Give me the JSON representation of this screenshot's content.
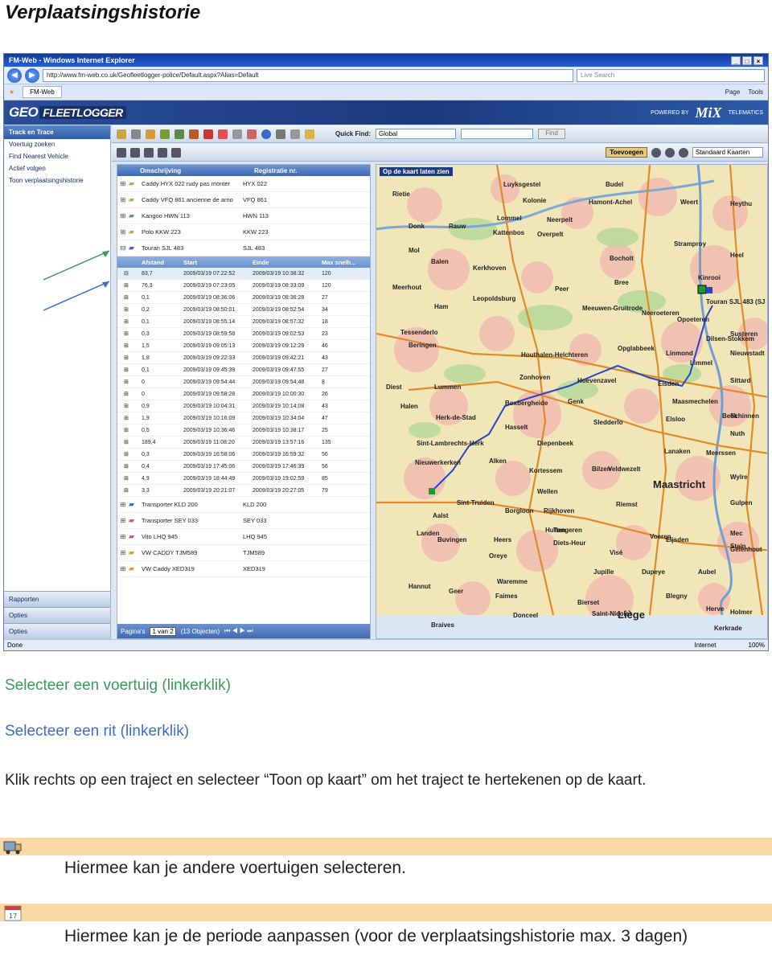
{
  "doc_title": "Verplaatsingshistorie",
  "browser": {
    "title": "FM-Web - Windows Internet Explorer",
    "url": "http://www.fm-web.co.uk/Geofleetlogger-police/Default.aspx?Alias=Default",
    "search_placeholder": "Live Search",
    "tab": "FM-Web",
    "tools": [
      "Page",
      "Tools"
    ],
    "status_left": "Done",
    "status_zone": "Internet",
    "zoom": "100%"
  },
  "app": {
    "logo_geo": "GEO",
    "logo_fleet": "FLEETLOGGER",
    "powered_by": "POWERED BY",
    "mix": "MiX",
    "telematics": "TELEMATICS"
  },
  "left_menu": {
    "header": "Track en Trace",
    "items": [
      "Voertuig zoeken",
      "Find Nearest Vehicle",
      "Actief volgen",
      "Toon verplaatsingshistorie"
    ],
    "bottom": [
      "Rapporten",
      "Opties",
      "Opties"
    ]
  },
  "toolbar": {
    "quick_find_label": "Quick Find:",
    "quick_find_value": "Global",
    "find_button": "Find",
    "add_button": "Toevoegen",
    "map_select": "Standaard Kaarten"
  },
  "grid": {
    "columns": [
      "Omschrijving",
      "Registratie nr."
    ],
    "vehicles_top": [
      {
        "name": "Caddy HYX 022 rudy pas monter",
        "reg": "HYX 022"
      },
      {
        "name": "Caddy VFQ 861 ancienne de arno",
        "reg": "VFQ 861"
      },
      {
        "name": "Kangoo HWN 113",
        "reg": "HWN 113"
      },
      {
        "name": "Polo KKW 223",
        "reg": "KKW 223"
      },
      {
        "name": "Touran SJL 483",
        "reg": "SJL 483"
      }
    ],
    "trip_columns": [
      "Afstand",
      "Start",
      "Einde",
      "Max snelh..."
    ],
    "trips": [
      {
        "d": "83,7",
        "s": "2009/03/19 07:22:52",
        "e": "2009/03/19 10:38:32",
        "m": "120"
      },
      {
        "d": "76,3",
        "s": "2009/03/19 07:23:05",
        "e": "2009/03/19 08:33:09",
        "m": "120"
      },
      {
        "d": "0,1",
        "s": "2009/03/19 08:36:06",
        "e": "2009/03/19 08:36:28",
        "m": "27"
      },
      {
        "d": "0,2",
        "s": "2009/03/19 08:50:01",
        "e": "2009/03/19 08:52:54",
        "m": "34"
      },
      {
        "d": "0,1",
        "s": "2009/03/19 08:55:14",
        "e": "2009/03/19 08:57:32",
        "m": "18"
      },
      {
        "d": "0,3",
        "s": "2009/03/19 08:59:58",
        "e": "2009/03/19 09:02:53",
        "m": "23"
      },
      {
        "d": "1,5",
        "s": "2009/03/19 09:05:13",
        "e": "2009/03/19 09:12:29",
        "m": "46"
      },
      {
        "d": "1,8",
        "s": "2009/03/19 09:22:33",
        "e": "2009/03/19 09:42:21",
        "m": "43"
      },
      {
        "d": "0,1",
        "s": "2009/03/19 09:45:39",
        "e": "2009/03/19 09:47:55",
        "m": "27"
      },
      {
        "d": "0",
        "s": "2009/03/19 09:54:44",
        "e": "2009/03/19 09:54:48",
        "m": "8"
      },
      {
        "d": "0",
        "s": "2009/03/19 09:58:28",
        "e": "2009/03/19 10:00:30",
        "m": "26"
      },
      {
        "d": "0,9",
        "s": "2009/03/19 10:04:31",
        "e": "2009/03/19 10:14:08",
        "m": "43"
      },
      {
        "d": "1,9",
        "s": "2009/03/19 10:16:09",
        "e": "2009/03/19 10:34:04",
        "m": "47"
      },
      {
        "d": "0,5",
        "s": "2009/03/19 10:36:46",
        "e": "2009/03/19 10:38:17",
        "m": "25"
      },
      {
        "d": "189,4",
        "s": "2009/03/19 11:08:20",
        "e": "2009/03/19 13:57:16",
        "m": "135"
      },
      {
        "d": "0,3",
        "s": "2009/03/19 16:58:06",
        "e": "2009/03/19 16:59:32",
        "m": "56"
      },
      {
        "d": "0,4",
        "s": "2009/03/19 17:45:06",
        "e": "2009/03/19 17:46:39",
        "m": "56"
      },
      {
        "d": "4,9",
        "s": "2009/03/19 18:44:49",
        "e": "2009/03/19 19:02:59",
        "m": "85"
      },
      {
        "d": "3,3",
        "s": "2009/03/19 20:21:07",
        "e": "2009/03/19 20:27:05",
        "m": "79"
      }
    ],
    "vehicles_bottom": [
      {
        "name": "Transporter KLD 200",
        "reg": "KLD 200"
      },
      {
        "name": "Transporter SEY 033",
        "reg": "SEY 033"
      },
      {
        "name": "Vito LHQ 945",
        "reg": "LHQ 945"
      },
      {
        "name": "VW CADDY TJM589",
        "reg": "TJM589"
      },
      {
        "name": "VW Caddy XED319",
        "reg": "XED319"
      }
    ],
    "pager_label": "Pagina's",
    "pager_value": "1 van 2",
    "pager_count": "(13 Objecten)"
  },
  "map": {
    "header": "Op de kaart laten zien",
    "labels": [
      "Luyksgestel",
      "Budel",
      "Kolonie",
      "Hamont-Achel",
      "Weert",
      "Heythu",
      "Rietie",
      "Lommel",
      "Neerpelt",
      "Donk",
      "Rauw",
      "Kattenbos",
      "Overpelt",
      "Stramproy",
      "Mol",
      "Balen",
      "Bocholt",
      "Heel",
      "Kerkhoven",
      "Kinrooi",
      "Meerhout",
      "Peer",
      "Bree",
      "Leopoldsburg",
      "Ham",
      "Meeuwen-Gruitrode",
      "Neeroeteren",
      "Tessenderlo",
      "Opoeteren",
      "Susteren",
      "Beringen",
      "Opglabbeek",
      "Dilsen-Stokkem",
      "Nieuwstadt",
      "Houthalen-Helchteren",
      "Zonhoven",
      "Hoevenzavel",
      "Eisden",
      "Lummen",
      "Diest",
      "Genk",
      "Maasmechelen",
      "Sittard",
      "Halen",
      "Boxbergheide",
      "Elsloo",
      "Beek",
      "Hasselt",
      "Sledderlo",
      "Schinnen",
      "Herk-de-Stad",
      "Nuth",
      "Sint-Lambrechts-Herk",
      "Diepenbeek",
      "Lanaken",
      "Meerssen",
      "Nieuwerkerken",
      "Alken",
      "Bilzen",
      "Veldwezelt",
      "Maastricht",
      "Kortessem",
      "Wellen",
      "Rijkhoven",
      "Riemst",
      "Sint-Truiden",
      "Borgloon",
      "Tongeren",
      "Eijsden",
      "Aalst",
      "Landen",
      "Buvingen",
      "Heers",
      "Hutten",
      "Voeren",
      "Diets-Heur",
      "Visé",
      "Oreye",
      "Jupille",
      "Dupeye",
      "Aubel",
      "Waremme",
      "Hannut",
      "Geer",
      "Faimes",
      "Bierset",
      "Blegny",
      "Donceel",
      "Saint-Nicolas",
      "Liège",
      "Braives",
      "Herve",
      "Touran SJL 483 (SJ",
      "Limmel",
      "Gulpen",
      "Wylre",
      "Stein",
      "Mec",
      "Linmond",
      "Kerkrade",
      "Holmer",
      "Gelenhout"
    ]
  },
  "captions": {
    "select_vehicle": "Selecteer een voertuig (linkerklik)",
    "select_trip": "Selecteer een rit (linkerklik)",
    "instruction": "Klik rechts op een traject en selecteer “Toon op kaart” om het traject te hertekenen op de kaart.",
    "tip_vehicle": "Hiermee kan je andere voertuigen selecteren.",
    "tip_period": "Hiermee kan je de periode aanpassen (voor de verplaatsingshistorie max. 3 dagen)"
  },
  "colors": {
    "green_caption": "#3a9a5a",
    "blue_caption": "#3d6ec9",
    "band": "#f8d9a6"
  }
}
